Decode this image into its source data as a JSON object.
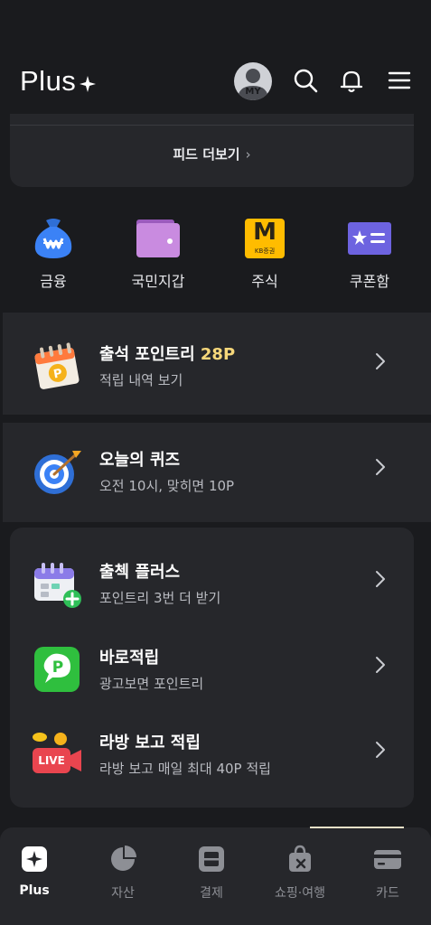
{
  "header": {
    "logo": "Plus",
    "avatar_label": "MY",
    "icons": [
      "search-icon",
      "bell-icon",
      "menu-icon"
    ]
  },
  "feed": {
    "more_label": "피드 더보기"
  },
  "shortcuts": [
    {
      "label": "금융",
      "icon": "money-bag-icon"
    },
    {
      "label": "국민지갑",
      "icon": "wallet-icon"
    },
    {
      "label": "주식",
      "icon": "kb-securities-icon",
      "badge": "M",
      "badge_sub": "KB증권"
    },
    {
      "label": "쿠폰함",
      "icon": "coupon-icon"
    }
  ],
  "rows": [
    {
      "title": "출석 포인트리 ",
      "highlight": "28P",
      "subtitle": "적립 내역 보기",
      "icon": "attendance-calendar-icon"
    },
    {
      "title": "오늘의 퀴즈",
      "subtitle": "오전 10시, 맞히면 10P",
      "icon": "target-icon"
    },
    {
      "title": "출첵 플러스",
      "subtitle": "포인트리 3번 더 받기",
      "icon": "calendar-plus-icon"
    },
    {
      "title": "바로적립",
      "subtitle": "광고보면 포인트리",
      "icon": "p-chat-icon"
    },
    {
      "title": "라방 보고 적립",
      "subtitle": "라방 보고 매일 최대 40P 적립",
      "icon": "live-camera-icon",
      "badge": "LIVE"
    }
  ],
  "bottom_nav": [
    {
      "label": "Plus",
      "icon": "plus-star-icon",
      "active": true
    },
    {
      "label": "자산",
      "icon": "pie-chart-icon",
      "active": false
    },
    {
      "label": "결제",
      "icon": "scan-icon",
      "active": false
    },
    {
      "label": "쇼핑·여행",
      "icon": "shopping-bag-icon",
      "active": false
    },
    {
      "label": "카드",
      "icon": "card-icon",
      "active": false
    }
  ],
  "colors": {
    "background": "#1a1b1e",
    "card": "#26272b",
    "highlight": "#f6d77a",
    "subtext": "#b9bbc1"
  }
}
